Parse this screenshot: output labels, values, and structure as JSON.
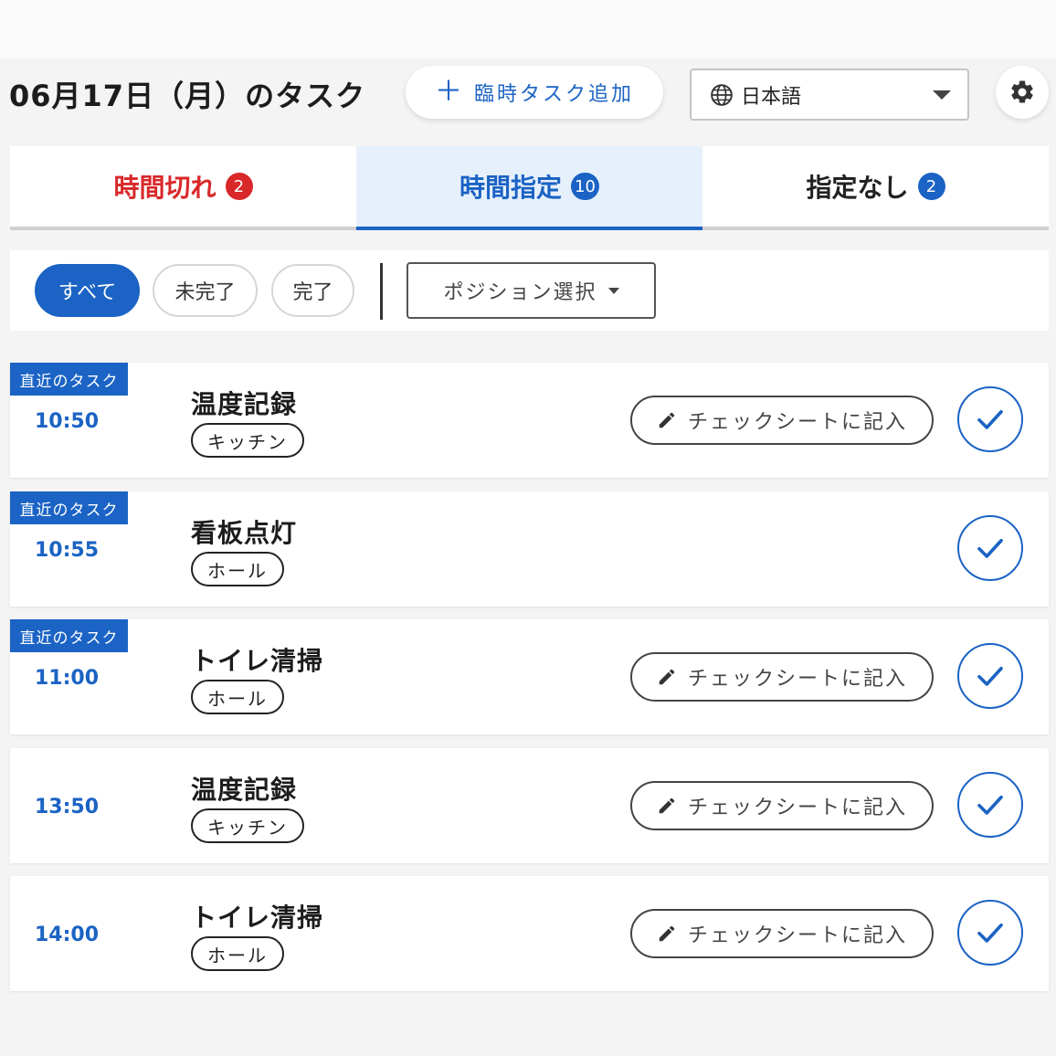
{
  "header": {
    "title": "06月17日（月）のタスク",
    "add_task_label": "臨時タスク追加",
    "language": "日本語"
  },
  "tabs": [
    {
      "label": "時間切れ",
      "count": "2",
      "color": "#d9282a"
    },
    {
      "label": "時間指定",
      "count": "10",
      "color": "#1b63c4"
    },
    {
      "label": "指定なし",
      "count": "2",
      "color": "#1b63c4"
    }
  ],
  "active_tab": "時間指定",
  "filters": {
    "all": "すべて",
    "incomplete": "未完了",
    "complete": "完了",
    "active": "すべて",
    "position_select": "ポジション選択"
  },
  "sheet_button_label": "チェックシートに記入",
  "tasks": [
    {
      "badge": "直近のタスク",
      "time": "10:50",
      "name": "温度記録",
      "position": "キッチン",
      "has_sheet": true
    },
    {
      "badge": "直近のタスク",
      "time": "10:55",
      "name": "看板点灯",
      "position": "ホール",
      "has_sheet": false
    },
    {
      "badge": "直近のタスク",
      "time": "11:00",
      "name": "トイレ清掃",
      "position": "ホール",
      "has_sheet": true
    },
    {
      "badge": "",
      "time": "13:50",
      "name": "温度記録",
      "position": "キッチン",
      "has_sheet": true
    },
    {
      "badge": "",
      "time": "14:00",
      "name": "トイレ清掃",
      "position": "ホール",
      "has_sheet": true
    }
  ],
  "colors": {
    "accent": "#1b63c4",
    "alert": "#d9282a",
    "active_tab_bg": "#e6f0fb"
  },
  "icons": {
    "add": "plus-icon",
    "language": "globe-icon",
    "settings": "gear-icon",
    "sheet": "pencil-icon",
    "complete": "check-icon"
  }
}
